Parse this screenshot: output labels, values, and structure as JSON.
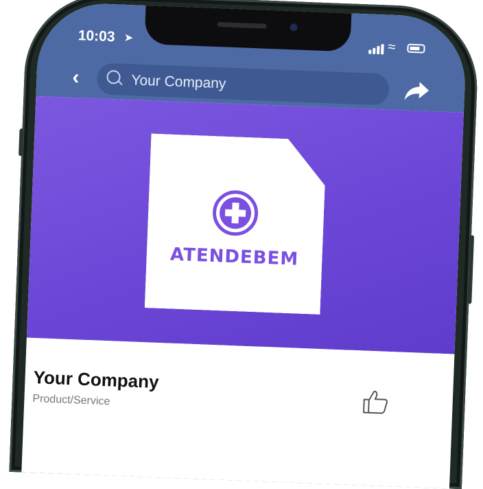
{
  "status_bar": {
    "time": "10:03",
    "location_icon": "location-arrow-icon",
    "signal_icon": "cellular-signal-icon",
    "wifi_icon": "wifi-icon",
    "battery_icon": "battery-icon"
  },
  "nav": {
    "back_icon": "chevron-left-icon",
    "search_value": "Your Company",
    "share_icon": "share-arrow-icon"
  },
  "cover": {
    "background_color": "#7056da",
    "logo_text": "ATENDEBEM",
    "logo_color": "#7b4fe0"
  },
  "profile": {
    "name": "Your Company",
    "category": "Product/Service",
    "like_icon": "thumbs-up-icon"
  },
  "colors": {
    "topbar": "#4e6aa4",
    "accent": "#7b4fe0"
  }
}
